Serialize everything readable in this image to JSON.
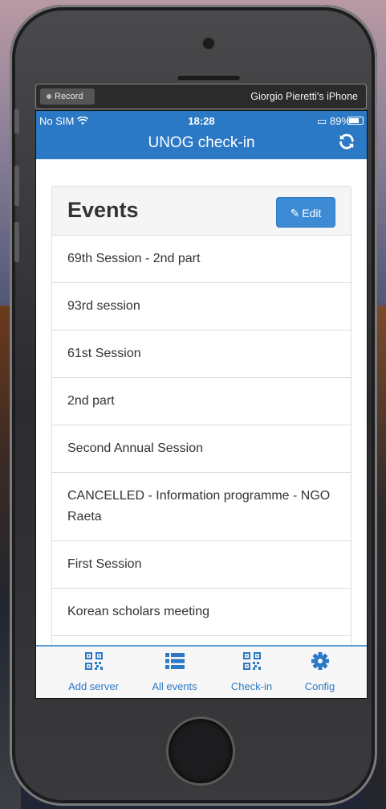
{
  "recorder": {
    "record_label": "Record",
    "device_name": "Giorgio Pieretti's iPhone"
  },
  "status_bar": {
    "carrier": "No SIM",
    "wifi_icon": "wifi-icon",
    "time": "18:28",
    "battery": "89%",
    "battery_level": 0.89
  },
  "app": {
    "title": "UNOG check-in",
    "refresh_icon": "refresh-icon"
  },
  "events": {
    "heading": "Events",
    "edit_label": "Edit",
    "items": [
      "69th Session - 2nd part",
      "93rd session",
      "61st Session",
      "2nd part",
      "Second Annual Session",
      "CANCELLED - Information programme - NGO Raeta",
      "First Session",
      "Korean scholars meeting"
    ]
  },
  "tabs": [
    {
      "label": "Add server",
      "icon": "qr-code-icon"
    },
    {
      "label": "All events",
      "icon": "list-icon"
    },
    {
      "label": "Check-in",
      "icon": "qr-code-icon"
    },
    {
      "label": "Config",
      "icon": "gear-icon"
    }
  ],
  "colors": {
    "accent": "#2b78c5",
    "edit_button": "#3d8ad5",
    "panel_header": "#f5f5f5"
  }
}
